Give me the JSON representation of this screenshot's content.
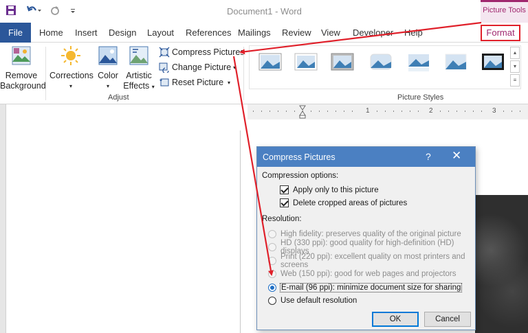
{
  "window": {
    "title": "Document1  -  Word",
    "context_tab_group": "Picture Tools"
  },
  "tabs": {
    "file": "File",
    "home": "Home",
    "insert": "Insert",
    "design": "Design",
    "layout": "Layout",
    "references": "References",
    "mailings": "Mailings",
    "review": "Review",
    "view": "View",
    "developer": "Developer",
    "help": "Help",
    "format": "Format"
  },
  "ribbon": {
    "remove_background_line1": "Remove",
    "remove_background_line2": "Background",
    "corrections": "Corrections",
    "color": "Color",
    "artistic_line1": "Artistic",
    "artistic_line2": "Effects",
    "compress_pictures": "Compress Pictures",
    "change_picture": "Change Picture",
    "reset_picture": "Reset Picture",
    "adjust_group": "Adjust",
    "picture_styles_group": "Picture Styles"
  },
  "ruler": {
    "ticks": [
      "1",
      "2",
      "3"
    ]
  },
  "dialog": {
    "title": "Compress Pictures",
    "help": "?",
    "compression_options": "Compression options:",
    "apply_only": "Apply only to this picture",
    "delete_cropped": "Delete cropped areas of pictures",
    "resolution": "Resolution:",
    "options": [
      {
        "label": "High fidelity: preserves quality of the original picture",
        "enabled": false,
        "selected": false
      },
      {
        "label": "HD (330 ppi): good quality for high-definition (HD) displays",
        "enabled": false,
        "selected": false
      },
      {
        "label": "Print (220 ppi): excellent quality on most printers and screens",
        "enabled": false,
        "selected": false
      },
      {
        "label": "Web (150 ppi): good for web pages and projectors",
        "enabled": false,
        "selected": false
      },
      {
        "label": "E-mail (96 ppi): minimize document size for sharing",
        "enabled": true,
        "selected": true
      },
      {
        "label": "Use default resolution",
        "enabled": true,
        "selected": false
      }
    ],
    "ok": "OK",
    "cancel": "Cancel"
  },
  "colors": {
    "word_blue": "#2b579a",
    "picture_tools_accent": "#a0276e",
    "annotation_red": "#e0202a",
    "dialog_title_blue": "#4b80c2"
  }
}
